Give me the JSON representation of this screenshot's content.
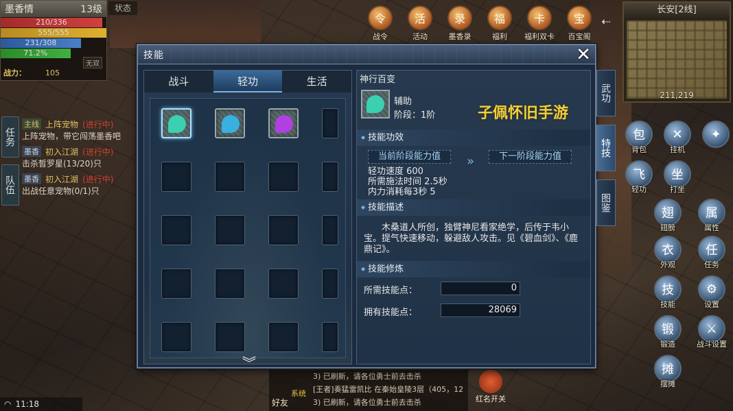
{
  "player": {
    "name": "墨香情",
    "level": "13级",
    "status_tab": "状态",
    "hp": "210/336",
    "mp": "555/555",
    "sp": "231/308",
    "xp": "71.2%",
    "wushuang": "无双",
    "power_label": "战力：",
    "power_value": "105"
  },
  "quest_tracker": {
    "task_tab": "任务",
    "team_tab": "队伍",
    "items": [
      {
        "tag": "主线",
        "title": "上阵宠物",
        "state": "(进行中)",
        "desc": "上阵宠物，带它闯荡墨香吧"
      },
      {
        "tag": "墨香",
        "title": "初入江湖",
        "state": "(进行中)",
        "desc": "击杀皙罗星(13/20)只"
      },
      {
        "tag": "墨香",
        "title": "初入江湖",
        "state": "(进行中)",
        "desc": "出战任意宠物(0/1)只"
      }
    ]
  },
  "top_icons": [
    {
      "icon": "war-order-icon",
      "label": "战令",
      "glyph": "令"
    },
    {
      "icon": "activity-icon",
      "label": "活动",
      "glyph": "活"
    },
    {
      "icon": "scroll-icon",
      "label": "墨香录",
      "glyph": "录"
    },
    {
      "icon": "gift-icon",
      "label": "福利",
      "glyph": "福"
    },
    {
      "icon": "double-card-icon",
      "label": "福利双卡",
      "glyph": "卡"
    },
    {
      "icon": "treasure-icon",
      "label": "百宝阁",
      "glyph": "宝"
    }
  ],
  "minimap": {
    "title": "长安[2线]",
    "coords": "211,219"
  },
  "right_icons": [
    {
      "icon": "backpack-icon",
      "label": "背包",
      "glyph": "包"
    },
    {
      "icon": "auto-battle-icon",
      "label": "挂机",
      "glyph": "✕"
    },
    {
      "icon": "settings-diamond-icon",
      "label": "",
      "glyph": "✦"
    },
    {
      "icon": "qinggong-icon",
      "label": "轻功",
      "glyph": "飞"
    },
    {
      "icon": "meditate-icon",
      "label": "打坐",
      "glyph": "坐"
    },
    {
      "icon": "wings-icon",
      "label": "翅膀",
      "glyph": "翅"
    },
    {
      "icon": "attributes-icon",
      "label": "属性",
      "glyph": "属"
    },
    {
      "icon": "appearance-icon",
      "label": "外观",
      "glyph": "衣"
    },
    {
      "icon": "quest-icon",
      "label": "任务",
      "glyph": "任"
    },
    {
      "icon": "skill-icon",
      "label": "技能",
      "glyph": "技"
    },
    {
      "icon": "gear-icon",
      "label": "设置",
      "glyph": "⚙"
    },
    {
      "icon": "forge-icon",
      "label": "锻造",
      "glyph": "锻"
    },
    {
      "icon": "battle-settings-icon",
      "label": "战斗设置",
      "glyph": "⚔"
    },
    {
      "icon": "stall-icon",
      "label": "摆摊",
      "glyph": "摊"
    }
  ],
  "chat": {
    "friend_label": "好友",
    "sys_tag": "系统",
    "lines": [
      "3) 已刷新，请各位勇士前去击杀",
      "[王者]奏猛雷凯比 在秦始皇陵3层（405，12",
      "3) 已刷新，请各位勇士前去击杀"
    ],
    "redname_label": "红名开关"
  },
  "clock": "11:18",
  "skill_window": {
    "title": "技能",
    "close_glyph": "✕",
    "tabs": [
      "战斗",
      "轻功",
      "生活"
    ],
    "active_tab": 1,
    "side_tabs": [
      "武功",
      "特技",
      "图鉴"
    ],
    "skill_name": "神行百变",
    "skill_type": "辅助",
    "skill_stage": "阶段：1阶",
    "watermark": "子佩怀旧手游",
    "effect_head": "技能功效",
    "current_stage_btn": "当前阶段能力值",
    "next_stage_btn": "下一阶段能力值",
    "effects": [
      "轻功速度 600",
      "所需施法时间 2.5秒",
      "内力消耗每3秒 5"
    ],
    "desc_head": "技能描述",
    "desc": "木桑道人所创，独臂神尼看家绝学，后传于韦小宝。提气快速移动，躲避敌人攻击。见《碧血剑》、《鹿鼎记》。",
    "train_head": "技能修炼",
    "required_label": "所需技能点：",
    "required_value": "0",
    "owned_label": "拥有技能点：",
    "owned_value": "28069",
    "slot_colors": [
      "#3ad0b0",
      "#3ab0e0",
      "#b040e0"
    ]
  }
}
